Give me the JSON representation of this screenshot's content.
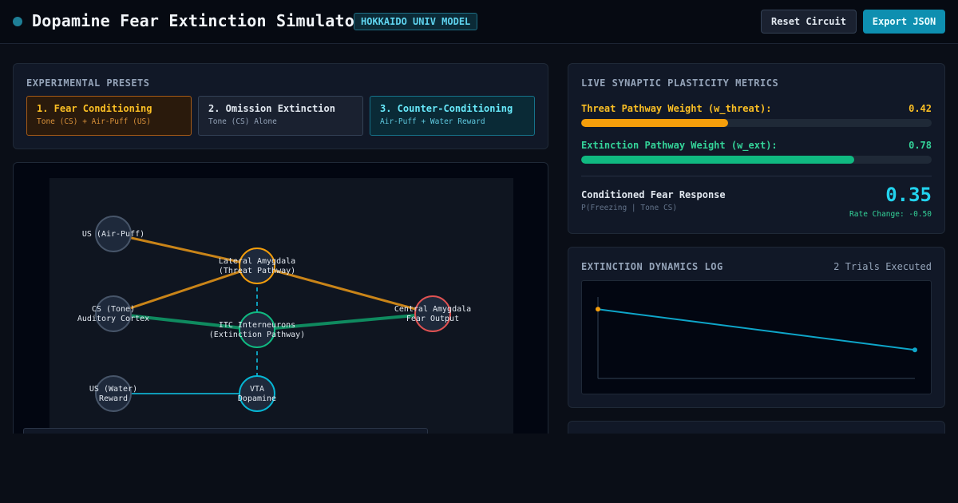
{
  "header": {
    "title": "Dopamine Fear Extinction Simulator",
    "badge": "HOKKAIDO UNIV MODEL",
    "reset_label": "Reset Circuit",
    "export_label": "Export JSON",
    "status_color": "#1e7f96"
  },
  "presets": {
    "heading": "EXPERIMENTAL PRESETS",
    "items": [
      {
        "title": "1. Fear Conditioning",
        "subtitle": "Tone (CS) + Air-Puff (US)",
        "active": true
      },
      {
        "title": "2. Omission Extinction",
        "subtitle": "Tone (CS) Alone",
        "active": false
      },
      {
        "title": "3. Counter-Conditioning",
        "subtitle": "Air-Puff + Water Reward",
        "active": false
      }
    ]
  },
  "circuit": {
    "nodes": {
      "us_air": "US (Air-Puff)",
      "la_line1": "Lateral Amygdala",
      "la_line2": "(Threat Pathway)",
      "cs_line1": "CS (Tone)",
      "cs_line2": "Auditory Cortex",
      "itc_line1": "ITC Interneurons",
      "itc_line2": "(Extinction Pathway)",
      "ca_line1": "Central Amygdala",
      "ca_line2": "Fear Output",
      "usw_line1": "US (Water)",
      "usw_line2": "Reward",
      "vta_line1": "VTA",
      "vta_line2": "Dopamine"
    },
    "colors": {
      "threat": "#d08a1e",
      "extinction": "#0f8a5f",
      "dopamine": "#0e9bb8",
      "output": "#e05252"
    }
  },
  "metrics": {
    "heading": "LIVE SYNAPTIC PLASTICITY METRICS",
    "threat": {
      "label": "Threat Pathway Weight (w_threat):",
      "value": "0.42",
      "fraction": 0.42,
      "color": "#f59e0b"
    },
    "extinction": {
      "label": "Extinction Pathway Weight (w_ext):",
      "value": "0.78",
      "fraction": 0.78,
      "color": "#10b981"
    },
    "cfr_label": "Conditioned Fear Response",
    "cfr_sub": "P(Freezing | Tone CS)",
    "cfr_value": "0.35",
    "cfr_rate": "Rate Change: -0.50"
  },
  "log": {
    "heading": "EXTINCTION DYNAMICS LOG",
    "count": "2 Trials Executed",
    "chart_data": {
      "type": "line",
      "x": [
        1,
        2
      ],
      "values": [
        0.85,
        0.35
      ],
      "ylim": [
        0,
        1
      ],
      "line_color": "#0ea5c9",
      "first_point_color": "#f59e0b"
    }
  }
}
